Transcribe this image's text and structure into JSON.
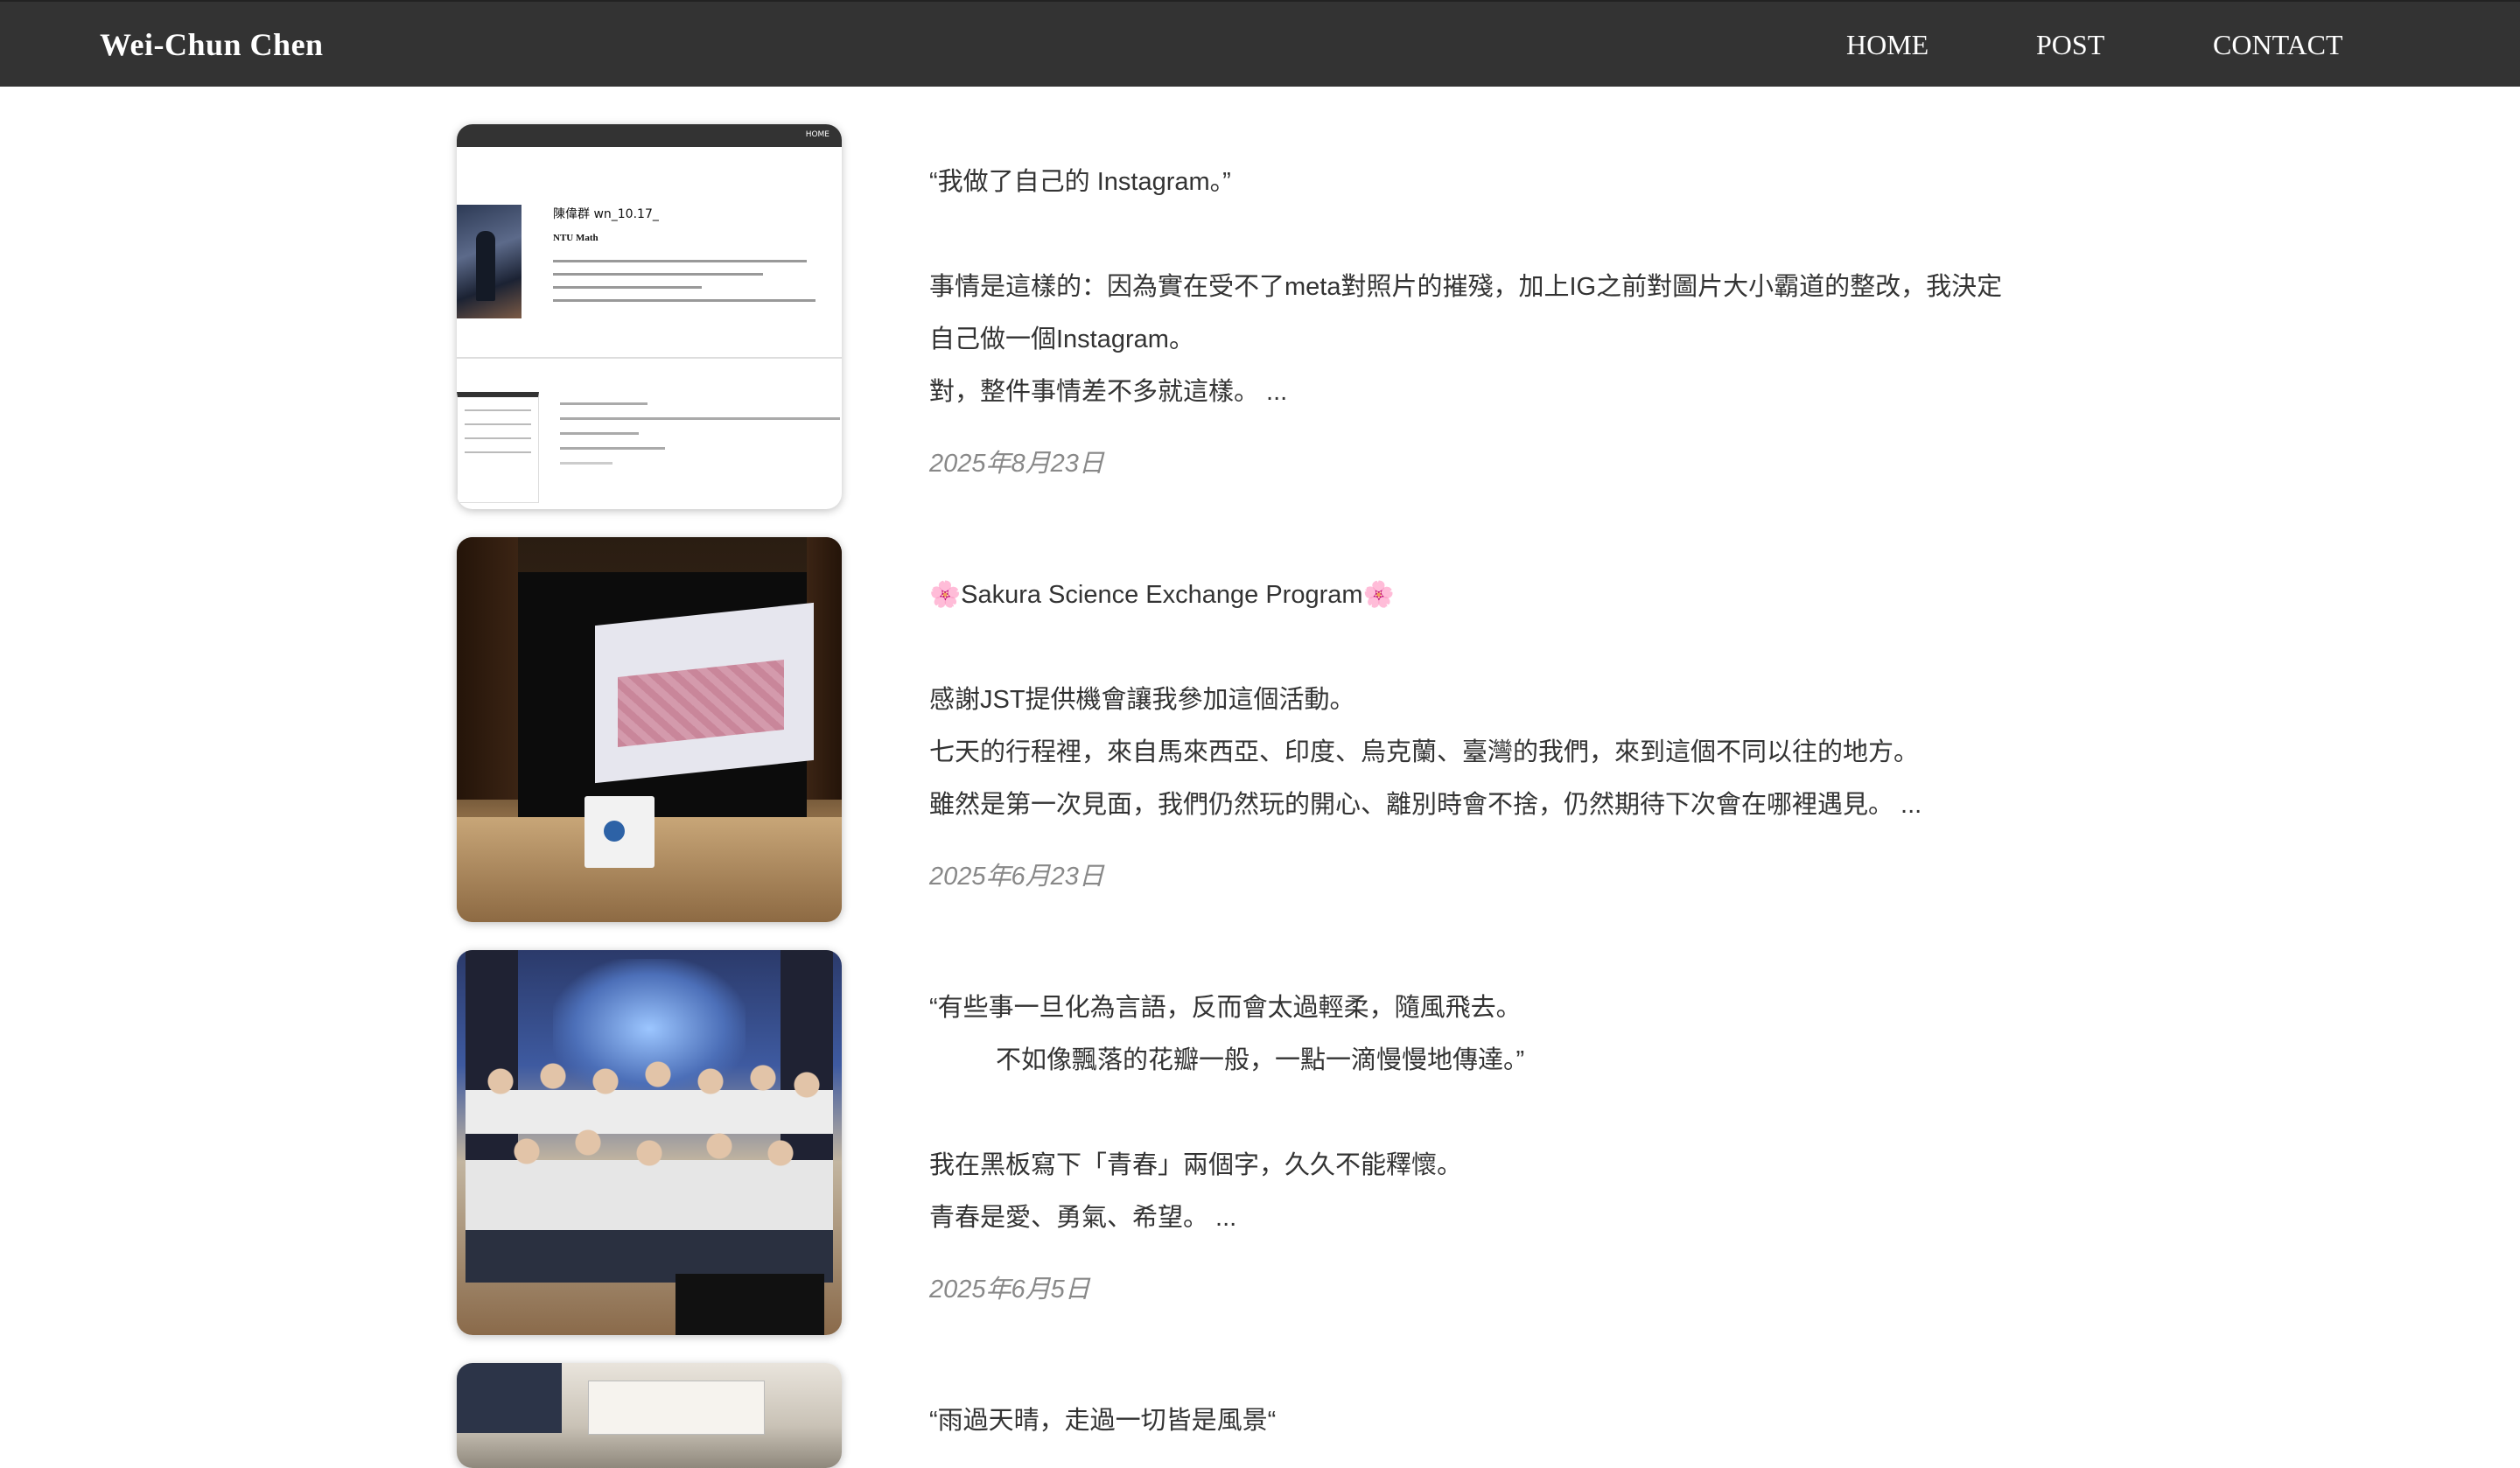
{
  "nav": {
    "brand": "Wei-Chun Chen",
    "links": [
      "HOME",
      "POST",
      "CONTACT"
    ]
  },
  "thumb1": {
    "home": "HOME",
    "name": "陳偉群 wn_10.17_",
    "subtitle": "NTU Math"
  },
  "posts": [
    {
      "lines": [
        "“我做了自己的 Instagram。”",
        "",
        "事情是這樣的：因為實在受不了meta對照片的摧殘，加上IG之前對圖片大小霸道的整改，我決定",
        "自己做一個Instagram。",
        "對，整件事情差不多就這樣。 ..."
      ],
      "date": "2025年8月23日"
    },
    {
      "lines": [
        "🌸Sakura Science Exchange Program🌸",
        "",
        "感謝JST提供機會讓我參加這個活動。",
        "七天的行程裡，來自馬來西亞、印度、烏克蘭、臺灣的我們，來到這個不同以往的地方。",
        "雖然是第一次見面，我們仍然玩的開心、離別時會不捨，仍然期待下次會在哪裡遇見。 ..."
      ],
      "date": "2025年6月23日"
    },
    {
      "lines": [
        "“有些事一旦化為言語，反而會太過輕柔，隨風飛去。",
        "不如像飄落的花瓣一般，一點一滴慢慢地傳達。”",
        "",
        "我在黑板寫下「青春」兩個字，久久不能釋懷。",
        "青春是愛、勇氣、希望。 ..."
      ],
      "date": "2025年6月5日"
    },
    {
      "lines": [
        "“雨過天晴，走過一切皆是風景“"
      ]
    }
  ]
}
